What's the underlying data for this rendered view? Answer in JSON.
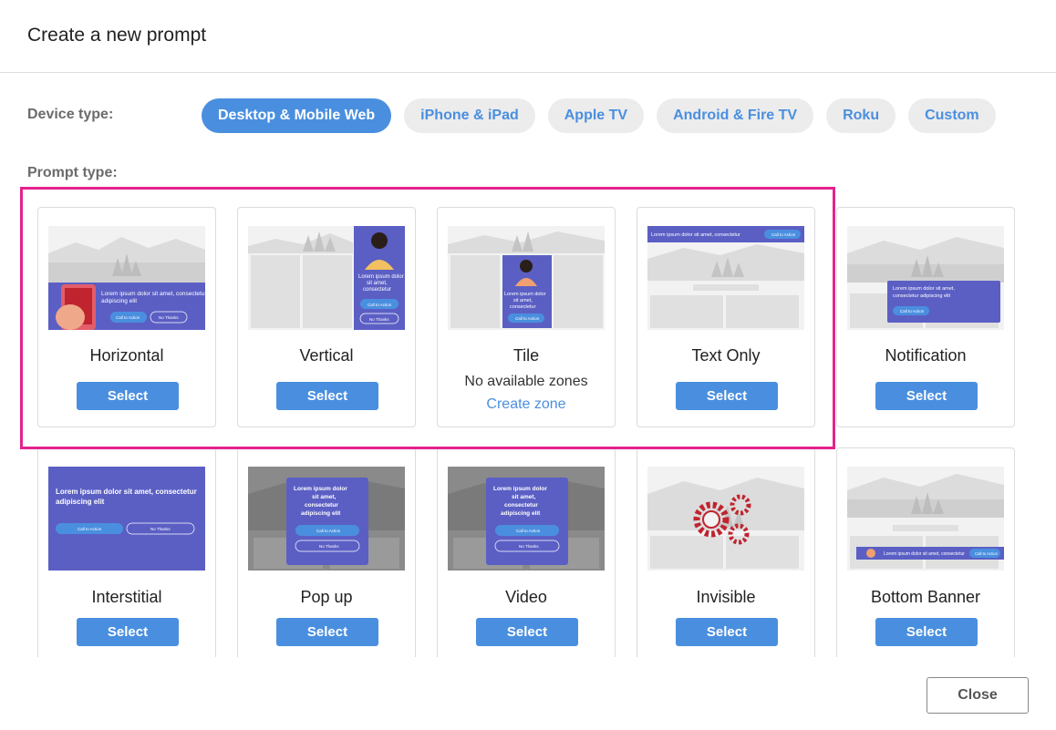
{
  "dialog": {
    "title": "Create a new prompt",
    "close_label": "Close"
  },
  "device": {
    "label": "Device type:",
    "options": [
      "Desktop & Mobile Web",
      "iPhone & iPad",
      "Apple TV",
      "Android & Fire TV",
      "Roku",
      "Custom"
    ],
    "selected": "Desktop & Mobile Web"
  },
  "prompt": {
    "label": "Prompt type:",
    "select_label": "Select",
    "cards": [
      {
        "name": "Horizontal"
      },
      {
        "name": "Vertical"
      },
      {
        "name": "Tile",
        "note": "No available zones",
        "link": "Create zone"
      },
      {
        "name": "Text Only"
      },
      {
        "name": "Notification"
      },
      {
        "name": "Interstitial"
      },
      {
        "name": "Pop up"
      },
      {
        "name": "Video"
      },
      {
        "name": "Invisible"
      },
      {
        "name": "Bottom Banner"
      }
    ]
  },
  "thumbs": {
    "lorem_one_line": "Lorem ipsum dolor sit amet, consectetur",
    "lorem_two_line_a": "Lorem ipsum dolor sit amet, consectetur",
    "lorem_two_line_b": "adipiscing elit",
    "lorem_short_a": "Lorem ipsum dolor",
    "lorem_short_b": "sit amet,",
    "lorem_short_c": "consectetur",
    "lorem_short_d": "adipiscing elit",
    "notif_a": "Lorem ipsum dolor sit amet,",
    "notif_b": "consectetur adipiscing elit",
    "cta": "Call to Action",
    "no_thanks": "No Thanks"
  },
  "colors": {
    "accent": "#4a8fdf",
    "highlight": "#e3238c",
    "promo": "#5b5fc4"
  }
}
